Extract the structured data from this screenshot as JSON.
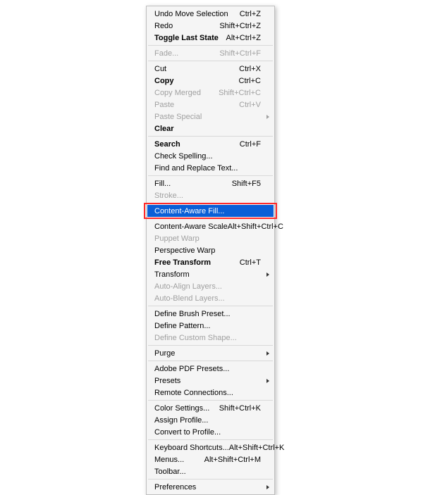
{
  "menu": {
    "groups": [
      [
        {
          "id": "undo-move-selection",
          "label": "Undo Move Selection",
          "shortcut": "Ctrl+Z"
        },
        {
          "id": "redo",
          "label": "Redo",
          "shortcut": "Shift+Ctrl+Z"
        },
        {
          "id": "toggle-last-state",
          "label": "Toggle Last State",
          "shortcut": "Alt+Ctrl+Z",
          "bold": true
        }
      ],
      [
        {
          "id": "fade",
          "label": "Fade...",
          "shortcut": "Shift+Ctrl+F",
          "disabled": true
        }
      ],
      [
        {
          "id": "cut",
          "label": "Cut",
          "shortcut": "Ctrl+X"
        },
        {
          "id": "copy",
          "label": "Copy",
          "shortcut": "Ctrl+C",
          "bold": true
        },
        {
          "id": "copy-merged",
          "label": "Copy Merged",
          "shortcut": "Shift+Ctrl+C",
          "disabled": true
        },
        {
          "id": "paste",
          "label": "Paste",
          "shortcut": "Ctrl+V",
          "disabled": true
        },
        {
          "id": "paste-special",
          "label": "Paste Special",
          "submenu": true,
          "disabled": true
        },
        {
          "id": "clear",
          "label": "Clear",
          "bold": true
        }
      ],
      [
        {
          "id": "search",
          "label": "Search",
          "shortcut": "Ctrl+F",
          "bold": true
        },
        {
          "id": "check-spelling",
          "label": "Check Spelling..."
        },
        {
          "id": "find-and-replace-text",
          "label": "Find and Replace Text..."
        }
      ],
      [
        {
          "id": "fill",
          "label": "Fill...",
          "shortcut": "Shift+F5"
        },
        {
          "id": "stroke",
          "label": "Stroke...",
          "disabled": true
        }
      ],
      [
        {
          "id": "content-aware-fill",
          "label": "Content-Aware Fill...",
          "highlight": true,
          "outline": true
        }
      ],
      [
        {
          "id": "content-aware-scale",
          "label": "Content-Aware Scale",
          "shortcut": "Alt+Shift+Ctrl+C"
        },
        {
          "id": "puppet-warp",
          "label": "Puppet Warp",
          "disabled": true
        },
        {
          "id": "perspective-warp",
          "label": "Perspective Warp"
        },
        {
          "id": "free-transform",
          "label": "Free Transform",
          "shortcut": "Ctrl+T",
          "bold": true
        },
        {
          "id": "transform",
          "label": "Transform",
          "submenu": true
        },
        {
          "id": "auto-align-layers",
          "label": "Auto-Align Layers...",
          "disabled": true
        },
        {
          "id": "auto-blend-layers",
          "label": "Auto-Blend Layers...",
          "disabled": true
        }
      ],
      [
        {
          "id": "define-brush-preset",
          "label": "Define Brush Preset..."
        },
        {
          "id": "define-pattern",
          "label": "Define Pattern..."
        },
        {
          "id": "define-custom-shape",
          "label": "Define Custom Shape...",
          "disabled": true
        }
      ],
      [
        {
          "id": "purge",
          "label": "Purge",
          "submenu": true
        }
      ],
      [
        {
          "id": "adobe-pdf-presets",
          "label": "Adobe PDF Presets..."
        },
        {
          "id": "presets",
          "label": "Presets",
          "submenu": true
        },
        {
          "id": "remote-connections",
          "label": "Remote Connections..."
        }
      ],
      [
        {
          "id": "color-settings",
          "label": "Color Settings...",
          "shortcut": "Shift+Ctrl+K"
        },
        {
          "id": "assign-profile",
          "label": "Assign Profile..."
        },
        {
          "id": "convert-to-profile",
          "label": "Convert to Profile..."
        }
      ],
      [
        {
          "id": "keyboard-shortcuts",
          "label": "Keyboard Shortcuts...",
          "shortcut": "Alt+Shift+Ctrl+K"
        },
        {
          "id": "menus",
          "label": "Menus...",
          "shortcut": "Alt+Shift+Ctrl+M"
        },
        {
          "id": "toolbar",
          "label": "Toolbar..."
        }
      ],
      [
        {
          "id": "preferences",
          "label": "Preferences",
          "submenu": true
        }
      ]
    ]
  }
}
